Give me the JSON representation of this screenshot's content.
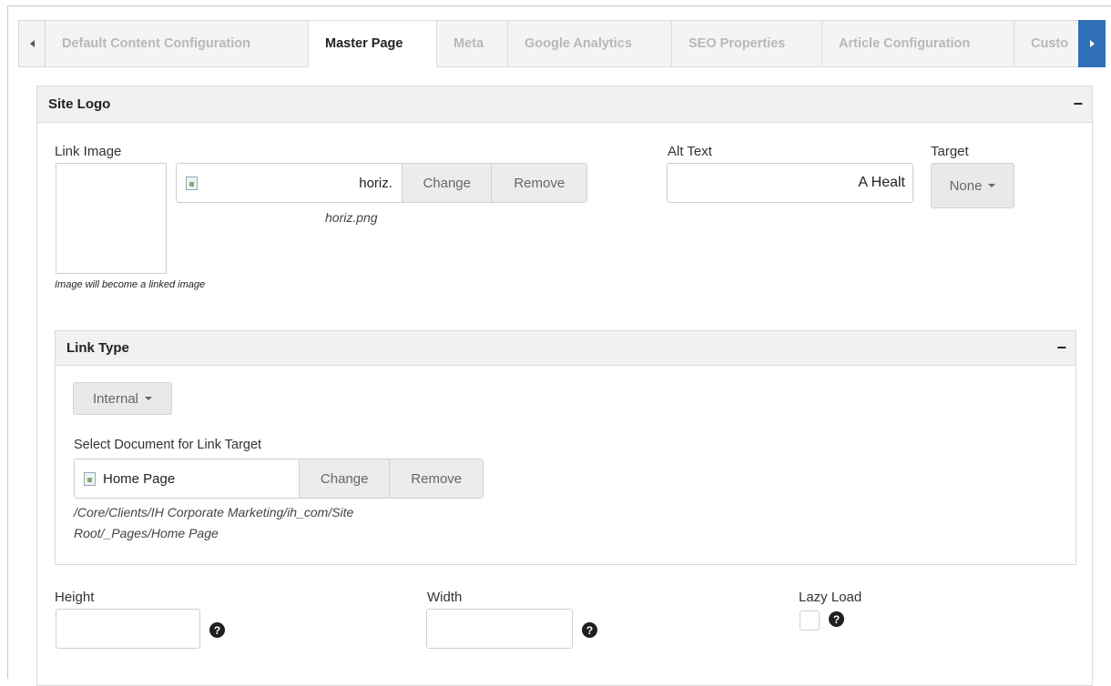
{
  "tabs": [
    {
      "label": "Default Content Configuration",
      "active": false
    },
    {
      "label": "Master Page",
      "active": true
    },
    {
      "label": "Meta",
      "active": false
    },
    {
      "label": "Google Analytics",
      "active": false
    },
    {
      "label": "SEO Properties",
      "active": false
    },
    {
      "label": "Article Configuration",
      "active": false
    },
    {
      "label": "Custo",
      "active": false
    }
  ],
  "site_logo": {
    "title": "Site Logo",
    "collapse_symbol": "−",
    "link_image": {
      "label": "Link Image",
      "file_name": "horiz.",
      "change_label": "Change",
      "remove_label": "Remove",
      "file_caption": "horiz.png",
      "hint": "Image will become a linked image"
    },
    "alt_text": {
      "label": "Alt Text",
      "value": "A Healt"
    },
    "target": {
      "label": "Target",
      "value": "None"
    },
    "link_type": {
      "title": "Link Type",
      "collapse_symbol": "−",
      "type_value": "Internal",
      "select_label": "Select Document for Link Target",
      "document_name": "Home Page",
      "change_label": "Change",
      "remove_label": "Remove",
      "path_line1": "/Core/Clients/IH Corporate Marketing/ih_com/Site",
      "path_line2": "Root/_Pages/Home Page"
    },
    "height": {
      "label": "Height",
      "value": ""
    },
    "width": {
      "label": "Width",
      "value": ""
    },
    "lazy_load": {
      "label": "Lazy Load",
      "checked": false
    },
    "help_symbol": "?"
  }
}
